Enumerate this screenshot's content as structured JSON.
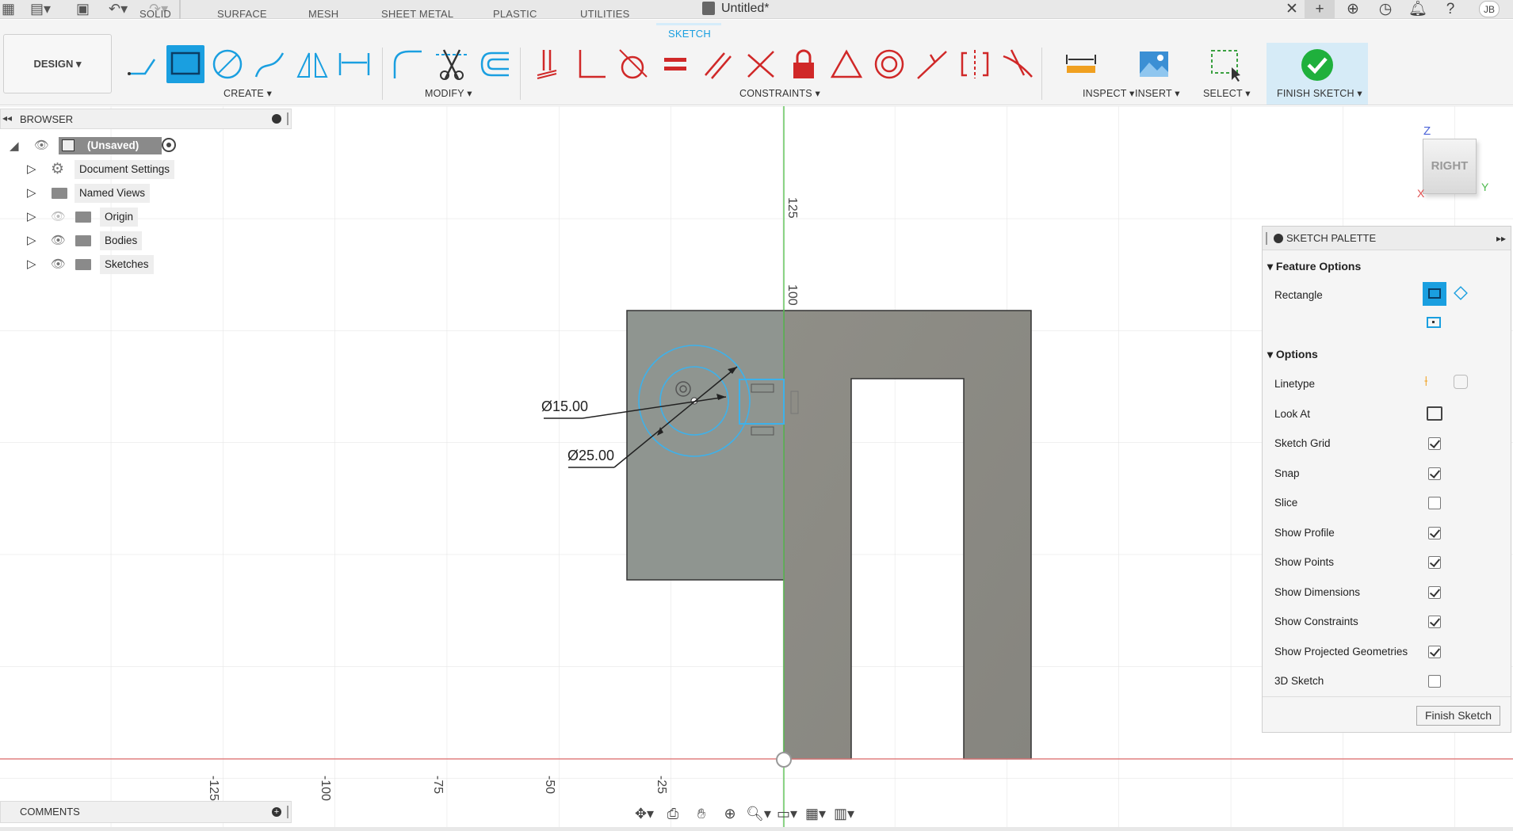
{
  "window": {
    "title": "Untitled*",
    "user_initials": "JB"
  },
  "workspace": {
    "label": "DESIGN"
  },
  "tabs": [
    {
      "label": "SOLID"
    },
    {
      "label": "SURFACE"
    },
    {
      "label": "MESH"
    },
    {
      "label": "SHEET METAL"
    },
    {
      "label": "PLASTIC"
    },
    {
      "label": "UTILITIES"
    },
    {
      "label": "SKETCH",
      "active": true
    }
  ],
  "groups": {
    "create": "CREATE",
    "modify": "MODIFY",
    "constraints": "CONSTRAINTS",
    "inspect": "INSPECT",
    "insert": "INSERT",
    "select": "SELECT",
    "finish": "FINISH SKETCH"
  },
  "browser": {
    "title": "BROWSER",
    "root": "(Unsaved)",
    "items": [
      {
        "label": "Document Settings",
        "icon": "gear-icon"
      },
      {
        "label": "Named Views",
        "icon": "folder-icon"
      },
      {
        "label": "Origin",
        "icon": "folder-icon"
      },
      {
        "label": "Bodies",
        "icon": "folder-icon"
      },
      {
        "label": "Sketches",
        "icon": "folder-icon"
      }
    ]
  },
  "comments": {
    "label": "COMMENTS"
  },
  "viewcube": {
    "face": "RIGHT",
    "axis_z": "Z",
    "axis_y": "Y",
    "axis_x": "X"
  },
  "sketch": {
    "dim_small": "Ø15.00",
    "dim_large": "Ø25.00",
    "vertical_ticks": [
      "125",
      "100"
    ],
    "horizontal_ticks": [
      "-125",
      "-100",
      "-75",
      "-50",
      "-25"
    ]
  },
  "palette": {
    "title": "SKETCH PALETTE",
    "feature_options": "Feature Options",
    "rectangle_label": "Rectangle",
    "options": "Options",
    "linetype": "Linetype",
    "look_at": "Look At",
    "rows": [
      {
        "label": "Sketch Grid",
        "checked": true
      },
      {
        "label": "Snap",
        "checked": true
      },
      {
        "label": "Slice",
        "checked": false
      },
      {
        "label": "Show Profile",
        "checked": true
      },
      {
        "label": "Show Points",
        "checked": true
      },
      {
        "label": "Show Dimensions",
        "checked": true
      },
      {
        "label": "Show Constraints",
        "checked": true
      },
      {
        "label": "Show Projected Geometries",
        "checked": true
      },
      {
        "label": "3D Sketch",
        "checked": false
      }
    ],
    "finish_button": "Finish Sketch"
  },
  "colors": {
    "accent": "#1a9fe0",
    "body": "#8d8c86",
    "profile": "#8f9590",
    "constraint": "#d02828"
  }
}
